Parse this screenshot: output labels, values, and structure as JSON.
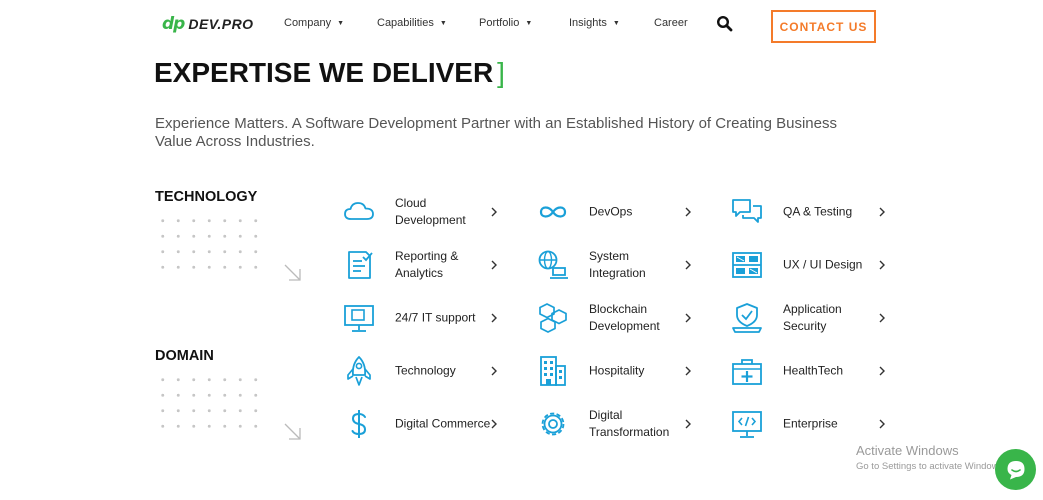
{
  "brand": {
    "mark": "dp",
    "name": "DEV.PRO",
    "accent_color": "#39b54a",
    "cta_color": "#f47b2a"
  },
  "nav": {
    "items": [
      {
        "label": "Company",
        "has_dropdown": true
      },
      {
        "label": "Capabilities",
        "has_dropdown": true
      },
      {
        "label": "Portfolio",
        "has_dropdown": true
      },
      {
        "label": "Insights",
        "has_dropdown": true
      },
      {
        "label": "Career",
        "has_dropdown": false
      }
    ],
    "search_icon": "search-icon",
    "contact_label": "CONTACT US"
  },
  "hero": {
    "title": "EXPERTISE WE DELIVER",
    "title_bracket": "]",
    "subtitle": "Experience Matters. A Software Development Partner with an Established History of Creating Business Value Across Industries."
  },
  "sections": {
    "technology": "TECHNOLOGY",
    "domain": "DOMAIN"
  },
  "services": [
    {
      "label": "Cloud Development",
      "icon": "cloud-icon"
    },
    {
      "label": "DevOps",
      "icon": "infinity-icon"
    },
    {
      "label": "QA & Testing",
      "icon": "chat-bubbles-icon"
    },
    {
      "label": "Reporting & Analytics",
      "icon": "report-icon"
    },
    {
      "label": "System Integration",
      "icon": "globe-laptop-icon"
    },
    {
      "label": "UX / UI Design",
      "icon": "wireframe-icon"
    },
    {
      "label": "24/7 IT support",
      "icon": "monitor-support-icon"
    },
    {
      "label": "Blockchain Development",
      "icon": "blockchain-cubes-icon"
    },
    {
      "label": "Application Security",
      "icon": "laptop-shield-icon"
    },
    {
      "label": "Technology",
      "icon": "rocket-icon"
    },
    {
      "label": "Hospitality",
      "icon": "hotel-building-icon"
    },
    {
      "label": "HealthTech",
      "icon": "medical-kit-icon"
    },
    {
      "label": "Digital Commerce",
      "icon": "dollar-icon"
    },
    {
      "label": "Digital Transformation",
      "icon": "gear-icon"
    },
    {
      "label": "Enterprise",
      "icon": "code-monitor-icon"
    }
  ],
  "watermark": {
    "title": "Activate Windows",
    "subtitle": "Go to Settings to activate Windows."
  },
  "chat": {
    "icon": "chat-icon"
  }
}
